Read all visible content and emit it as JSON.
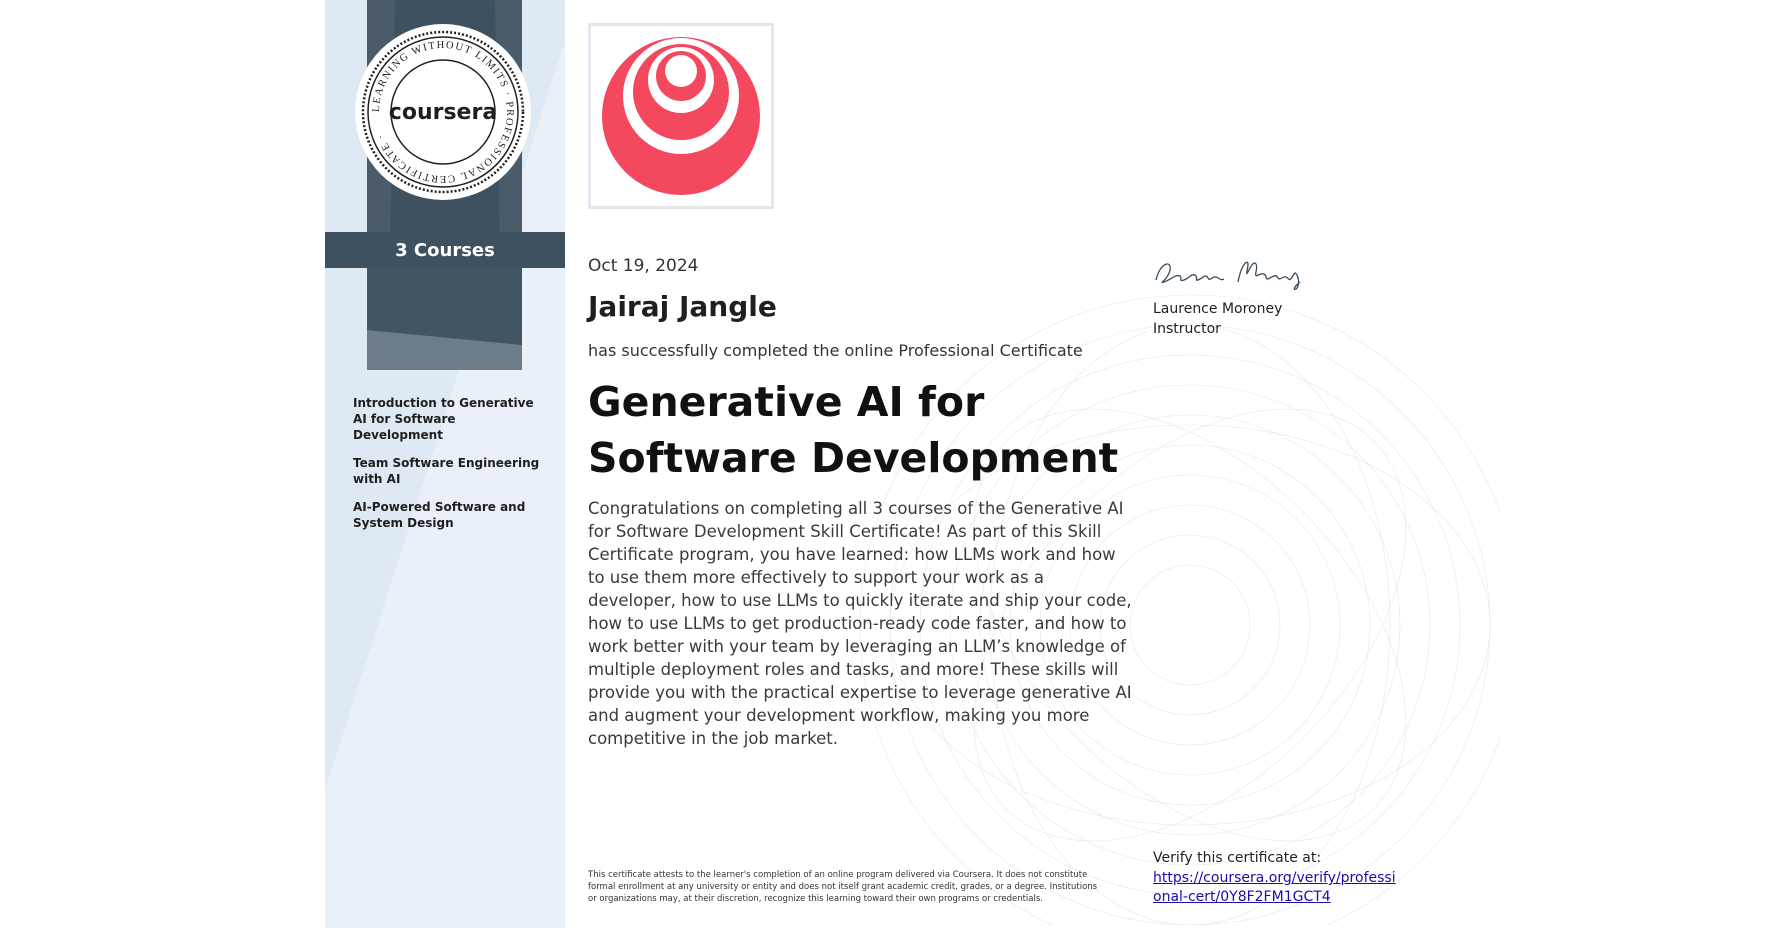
{
  "sidebar": {
    "seal_text": "LEARNING WITHOUT LIMITS · PROFESSIONAL CERTIFICATE ·",
    "seal_logo": "coursera",
    "courses_count_label": "3 Courses",
    "courses": [
      "Introduction to Generative AI for Software Development",
      "Team Software Engineering with AI",
      "AI-Powered Software and System Design"
    ]
  },
  "certificate": {
    "date": "Oct 19, 2024",
    "learner_name": "Jairaj Jangle",
    "completed_text": "has successfully completed the online Professional Certificate",
    "title_line1": "Generative AI for",
    "title_line2": "Software Development",
    "description": "Congratulations on completing all 3 courses of the Generative AI for Software Development Skill Certificate! As part of this Skill Certificate program, you have learned: how LLMs work and how to use them more effectively to support your work as a developer, how to use LLMs to quickly iterate and ship your code, how to use LLMs to get production-ready code faster, and how to work better with your team by leveraging an LLM’s knowledge of multiple deployment roles and tasks, and more! These skills will provide you with the practical expertise to leverage generative AI and augment your development workflow, making you more competitive in the job market.",
    "disclaimer": "This certificate attests to the learner's completion of an online program delivered via Coursera. It does not constitute formal enrollment at any university or entity and does not itself grant academic credit, grades, or a degree. Institutions or organizations may, at their discretion, recognize this learning toward their own programs or credentials."
  },
  "instructor": {
    "signature": "Laurence Moroney",
    "name": "Laurence Moroney",
    "role": "Instructor"
  },
  "verify": {
    "label": "Verify this certificate at:",
    "url": "https://coursera.org/verify/professional-cert/0Y8F2FM1GCT4"
  },
  "colors": {
    "sidebar_bg": "#dfe9f3",
    "ribbon_dark": "#3e5160",
    "logo_red": "#f4485e",
    "link": "#1a0dab"
  }
}
